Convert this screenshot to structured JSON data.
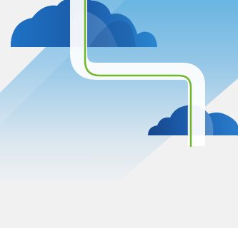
{
  "illustration": {
    "subject": "cloud-connection",
    "palette": {
      "background": "#f1f1f2",
      "sky_light": "#e2ebf2",
      "sky_blue": "#8cc3e6",
      "cloud_dark": "#1a4f99",
      "cloud_mid": "#1f6fbf",
      "cloud_light": "#3e9ad8",
      "path_white": "#ffffff",
      "connector_green": "#72b62c"
    },
    "elements": {
      "upper_cloud": "cloud-icon",
      "lower_cloud": "cloud-icon",
      "connector": "connection-line"
    }
  }
}
